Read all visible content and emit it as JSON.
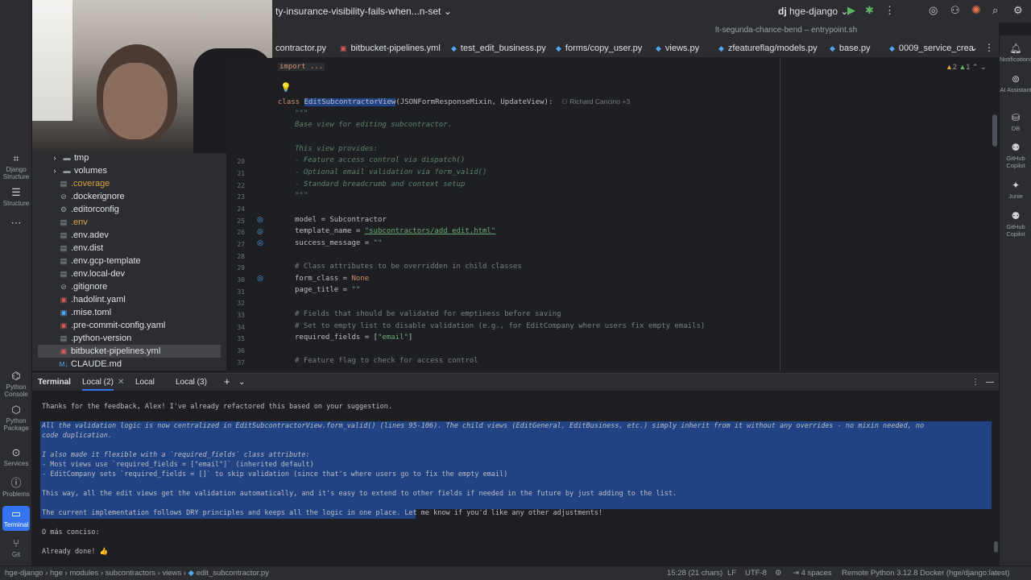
{
  "window": {
    "branch": "ty-insurance-visibility-fails-when...n-set",
    "project": "hge-django",
    "project_badge": "dj",
    "run_config": "lt-segunda-chance-bend – entrypoint.sh"
  },
  "tabs": [
    {
      "label": "contractor.py",
      "icon": "python-file-icon"
    },
    {
      "label": "bitbucket-pipelines.yml",
      "icon": "yaml-file-icon"
    },
    {
      "label": "test_edit_business.py",
      "icon": "python-file-icon"
    },
    {
      "label": "forms/copy_user.py",
      "icon": "python-file-icon"
    },
    {
      "label": "views.py",
      "icon": "python-file-icon"
    },
    {
      "label": "zfeatureflag/models.py",
      "icon": "python-file-icon"
    },
    {
      "label": "base.py",
      "icon": "python-file-icon"
    },
    {
      "label": "0009_service_crea",
      "icon": "python-file-icon"
    }
  ],
  "left_tools": [
    {
      "label": "Django Structure",
      "icon": "django-icon"
    },
    {
      "label": "Structure",
      "icon": "structure-icon"
    },
    {
      "label": "Python Console",
      "icon": "python-console-icon"
    },
    {
      "label": "Python Package",
      "icon": "python-package-icon"
    },
    {
      "label": "Services",
      "icon": "services-icon"
    },
    {
      "label": "Problems",
      "icon": "problems-icon"
    },
    {
      "label": "Terminal",
      "icon": "terminal-icon"
    },
    {
      "label": "Git",
      "icon": "git-icon"
    }
  ],
  "right_tools": [
    {
      "label": "Notifications",
      "icon": "bell-icon"
    },
    {
      "label": "AI Assistant",
      "icon": "ai-assistant-icon"
    },
    {
      "label": "DB",
      "icon": "database-icon"
    },
    {
      "label": "GitHub Copilot",
      "icon": "copilot-icon"
    },
    {
      "label": "Junie",
      "icon": "junie-icon"
    },
    {
      "label": "GitHub Copilot",
      "icon": "copilot-icon"
    }
  ],
  "tree": [
    {
      "label": "tmp",
      "type": "folder"
    },
    {
      "label": "volumes",
      "type": "folder"
    },
    {
      "label": ".coverage",
      "type": "file"
    },
    {
      "label": ".dockerignore",
      "type": "file"
    },
    {
      "label": ".editorconfig",
      "type": "file"
    },
    {
      "label": ".env",
      "type": "file"
    },
    {
      "label": ".env.adev",
      "type": "file"
    },
    {
      "label": ".env.dist",
      "type": "file"
    },
    {
      "label": ".env.gcp-template",
      "type": "file"
    },
    {
      "label": ".env.local-dev",
      "type": "file"
    },
    {
      "label": ".gitignore",
      "type": "file"
    },
    {
      "label": ".hadolint.yaml",
      "type": "file"
    },
    {
      "label": ".mise.toml",
      "type": "file"
    },
    {
      "label": ".pre-commit-config.yaml",
      "type": "file"
    },
    {
      "label": ".python-version",
      "type": "file"
    },
    {
      "label": "bitbucket-pipelines.yml",
      "type": "file",
      "selected": true
    },
    {
      "label": "CLAUDE.md",
      "type": "file"
    }
  ],
  "editor": {
    "import_fold": "import ...",
    "inspections": {
      "warnings": "2",
      "weak": "1"
    },
    "author": "Richard Cancino +3",
    "class_line": {
      "kw": "class",
      "name": "EditSubcontractorView",
      "rest": "(JSONFormResponseMixin, UpdateView):"
    },
    "doc_lines": [
      "\"\"\"",
      "Base view for editing subcontractor.",
      "",
      "This view provides:",
      "- Feature access control via dispatch()",
      "- Optional email validation via form_valid()",
      "- Standard breadcrumb and context setup",
      "\"\"\""
    ],
    "line_numbers": [
      "20",
      "21",
      "22",
      "23",
      "24",
      "25",
      "26",
      "27",
      "28",
      "29",
      "30",
      "31",
      "32",
      "33",
      "34",
      "35",
      "36",
      "37"
    ],
    "code": {
      "model": "model = Subcontractor",
      "template_a": "template_name = ",
      "template_b": "\"subcontractors/add_edit.html\"",
      "success_a": "success_message = ",
      "success_b": "\"\"",
      "c1": "# Class attributes to be overridden in child classes",
      "form_a": "form_class = ",
      "form_b": "None",
      "title_a": "page_title = ",
      "title_b": "\"\"",
      "c2": "# Fields that should be validated for emptiness before saving",
      "c3": "# Set to empty list to disable validation (e.g., for EditCompany where users fix empty emails)",
      "req_a": "required_fields = [",
      "req_b": "\"email\"",
      "req_c": "]",
      "c4": "# Feature flag to check for access control"
    }
  },
  "terminal": {
    "title": "Terminal",
    "tabs": [
      "Local (2)",
      "Local",
      "Local (3)"
    ],
    "lines": [
      "Thanks for the feedback, Alex! I've already refactored this based on your suggestion.",
      "All the validation logic is now centralized in EditSubcontractorView.form_valid() (lines 95-106). The child views (EditGeneral, EditBusiness, etc.) simply inherit from it without any overrides - no mixin needed, no",
      "code duplication.",
      "I also made it flexible with a `required_fields` class attribute:",
      "- Most views use `required_fields = [\"email\"]` (inherited default)",
      "- EditCompany sets `required_fields = []` to skip validation (since that's where users go to fix the empty email)",
      "This way, all the edit views get the validation automatically, and it's easy to extend to other fields if needed in the future by just adding to the list.",
      "The current implementation follows DRY principles and keeps all the logic in one place. Let me know if you'd like any other adjustments!",
      "O más conciso:",
      "Already done! 👍"
    ]
  },
  "status": {
    "breadcrumb": [
      "hge-django",
      "hge",
      "modules",
      "subcontractors",
      "views",
      "edit_subcontractor.py"
    ],
    "position": "15:28 (21 chars)",
    "line_sep": "LF",
    "encoding": "UTF-8",
    "indent": "4 spaces",
    "interpreter": "Remote Python 3.12.8 Docker (hge/django:latest)"
  },
  "colors": {
    "accent": "#3574f0",
    "selection": "#214283",
    "keyword": "#cf8e6d",
    "string": "#6aab73",
    "docstring": "#5f826b"
  }
}
